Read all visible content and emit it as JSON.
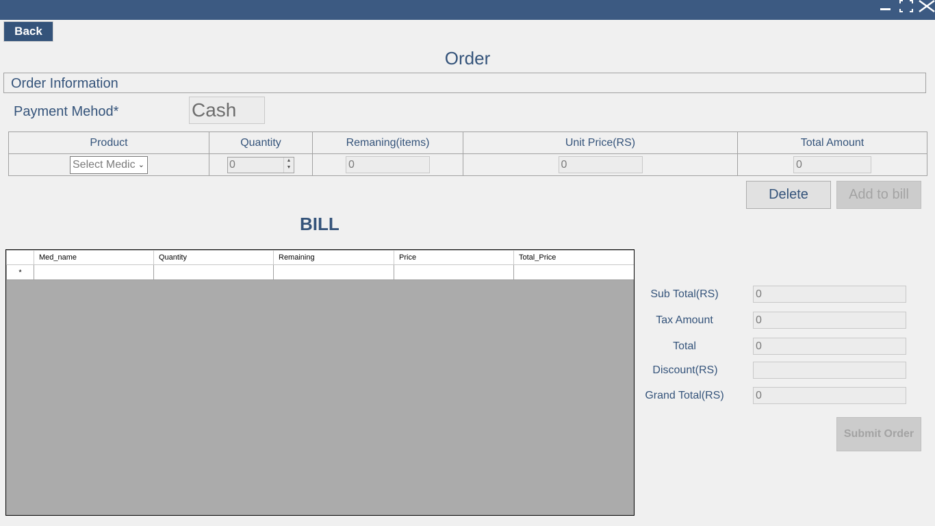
{
  "window": {
    "colors": {
      "titlebar": "#3c5a82",
      "accent": "#34537a",
      "background": "#f0f0f0"
    }
  },
  "header": {
    "back_label": "Back",
    "page_title": "Order"
  },
  "order_info": {
    "section_title": "Order Information",
    "payment_method_label": "Payment Mehod*",
    "payment_method_value": "Cash",
    "grid": {
      "headers": [
        "Product",
        "Quantity",
        "Remaning(items)",
        "Unit Price(RS)",
        "Total Amount"
      ],
      "product_select_value": "Select Medic",
      "quantity_value": "0",
      "remaining_value": "0",
      "unit_price_value": "0",
      "total_amount_value": "0"
    },
    "delete_label": "Delete",
    "add_to_bill_label": "Add to bill"
  },
  "bill": {
    "title": "BILL",
    "columns": [
      "Med_name",
      "Quantity",
      "Remaining",
      "Price",
      "Total_Price"
    ],
    "new_row_marker": "*"
  },
  "summary": {
    "sub_total_label": "Sub Total(RS)",
    "sub_total_value": "0",
    "tax_amount_label": "Tax Amount",
    "tax_amount_value": "0",
    "total_label": "Total",
    "total_value": "0",
    "discount_label": "Discount(RS)",
    "discount_value": "",
    "grand_total_label": "Grand Total(RS)",
    "grand_total_value": "0",
    "submit_label": "Submit Order"
  }
}
